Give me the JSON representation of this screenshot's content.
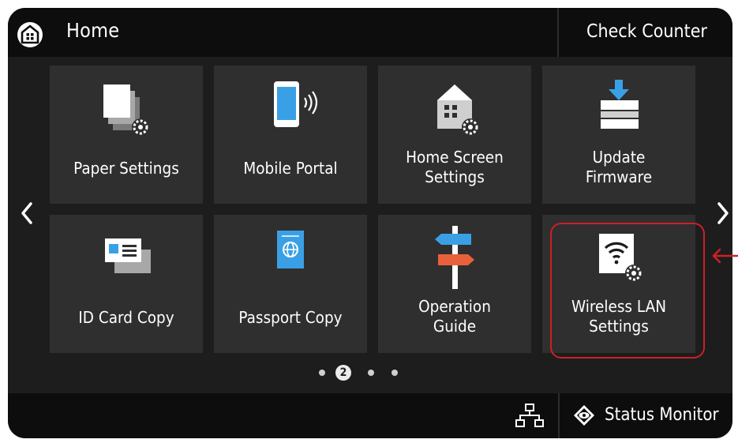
{
  "header": {
    "title": "Home",
    "check_counter": "Check Counter"
  },
  "tiles": [
    {
      "label": "Paper Settings"
    },
    {
      "label": "Mobile Portal"
    },
    {
      "label": "Home Screen Settings"
    },
    {
      "label": "Update Firmware"
    },
    {
      "label": "ID Card Copy"
    },
    {
      "label": "Passport Copy"
    },
    {
      "label": "Operation Guide"
    },
    {
      "label": "Wireless LAN Settings"
    }
  ],
  "pager": {
    "current": "2",
    "total": 4
  },
  "footer": {
    "status_monitor": "Status Monitor"
  },
  "colors": {
    "screen": "#1d1d1d",
    "tile": "#2f2f2f",
    "bar": "#0d0d0d",
    "highlight": "#cc2026",
    "accent_blue": "#3aa0e6",
    "accent_orange": "#e8613a"
  },
  "icons": [
    "home-icon",
    "paper-settings-icon",
    "mobile-portal-icon",
    "home-screen-settings-icon",
    "update-firmware-icon",
    "id-card-copy-icon",
    "passport-copy-icon",
    "operation-guide-icon",
    "wireless-lan-icon",
    "network-icon",
    "status-monitor-icon",
    "chevron-left-icon",
    "chevron-right-icon",
    "arrow-left-icon"
  ]
}
